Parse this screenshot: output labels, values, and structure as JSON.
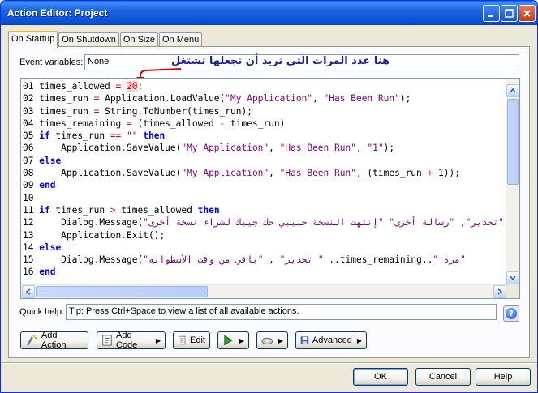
{
  "window": {
    "title": "Action Editor: Project"
  },
  "tabs": [
    "On Startup",
    "On Shutdown",
    "On Size",
    "On Menu"
  ],
  "event_variables": {
    "label": "Event variables:",
    "value": "None"
  },
  "annotation": {
    "text": "هنا عدد المرات التي تريد أن تجعلها تشتغل"
  },
  "code": {
    "line_numbers": [
      "01",
      "02",
      "03",
      "04",
      "05",
      "06",
      "07",
      "08",
      "09",
      "10",
      "11",
      "12",
      "13",
      "14",
      "15",
      "16"
    ],
    "l01": {
      "a": "times_allowed ",
      "op": "=",
      "b": " ",
      "num": "20",
      "c": ";"
    },
    "l02": {
      "a": "times_run ",
      "op": "=",
      "b": " Application",
      "dot": ".",
      "c": "LoadValue(",
      "s1": "\"My Application\"",
      "d": ", ",
      "s2": "\"Has Been Run\"",
      "e": ");"
    },
    "l03": {
      "a": "times_run ",
      "op": "=",
      "b": " String",
      "dot": ".",
      "c": "ToNumber(times_run);"
    },
    "l04": {
      "a": "times_remaining ",
      "op": "=",
      "b": " (times_allowed ",
      "op2": "-",
      "c": " times_run)"
    },
    "l05": {
      "kw": "if",
      "a": " times_run ",
      "op": "==",
      "b": " ",
      "s": "\"\"",
      "c": " ",
      "kw2": "then"
    },
    "l06": {
      "a": "    Application",
      "dot": ".",
      "b": "SaveValue(",
      "s1": "\"My Application\"",
      "c": ", ",
      "s2": "\"Has Been Run\"",
      "d": ", ",
      "s3": "\"1\"",
      "e": ");"
    },
    "l07": {
      "kw": "else"
    },
    "l08": {
      "a": "    Application",
      "dot": ".",
      "b": "SaveValue(",
      "s1": "\"My Application\"",
      "c": ", ",
      "s2": "\"Has Been Run\"",
      "d": ", (times_run ",
      "op": "+",
      "e": " 1));"
    },
    "l09": {
      "kw": "end"
    },
    "l10": {
      "a": ""
    },
    "l11": {
      "kw": "if",
      "a": " times_run ",
      "op": ">",
      "b": " times_allowed ",
      "kw2": "then"
    },
    "l12": {
      "a": "    Dialog",
      "dot": ".",
      "b": "Message(",
      "s1": "\"تحذير\"",
      "c": ", ",
      "s2": "\"رسالة أخرى\"",
      "d": " ",
      "s3": "\"إنتهت النسخة حبيبي حك جيبك لشراء نسخة أخرى\""
    },
    "l13": {
      "a": "    Application",
      "dot": ".",
      "b": "Exit();"
    },
    "l14": {
      "kw": "else"
    },
    "l15": {
      "a": "    Dialog",
      "dot": ".",
      "b": "Message(",
      "s1": "\"تحذير\"",
      "c": " , ",
      "s2": "\"باقي من وقت الأسطوانة \"",
      "d": " ..",
      "e": "times_remaining",
      "f": "..",
      "s3": "\" مرة\""
    },
    "l16": {
      "kw": "end"
    }
  },
  "quick_help": {
    "label": "Quick help:",
    "value": "Tip: Press Ctrl+Space to view a list of all available actions."
  },
  "toolbar": {
    "add_action": "Add Action",
    "add_code": "Add Code",
    "edit": "Edit",
    "advanced": "Advanced"
  },
  "dialog": {
    "ok": "OK",
    "cancel": "Cancel",
    "help": "Help"
  },
  "colors": {
    "titlebar": "#0a50d8",
    "keyword": "#0000ff",
    "string": "#7f007f",
    "operator": "#ff0000",
    "annotation": "#1c1f9c"
  }
}
